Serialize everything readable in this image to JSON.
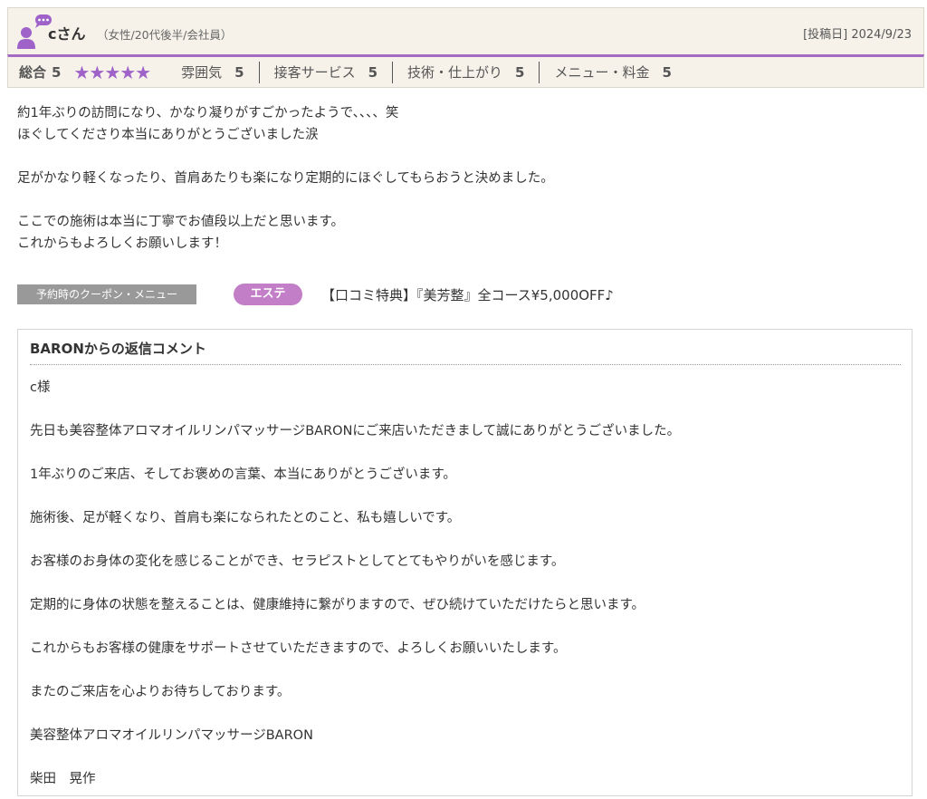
{
  "reviewer": {
    "name": "cさん",
    "attributes": "（女性/20代後半/会社員）",
    "post_date": "[投稿日] 2024/9/23",
    "avatar_icon": "user-comment-icon"
  },
  "ratings": {
    "overall_label": "総合",
    "overall_score": "5",
    "stars_text": "★★★★★",
    "star_count": 5,
    "star_color": "#9e62c9",
    "categories": [
      {
        "label": "雰囲気",
        "score": "5"
      },
      {
        "label": "接客サービス",
        "score": "5"
      },
      {
        "label": "技術・仕上がり",
        "score": "5"
      },
      {
        "label": "メニュー・料金",
        "score": "5"
      }
    ]
  },
  "review_body": "約1年ぶりの訪問になり、かなり凝りがすごかったようで、、、、笑\nほぐしてくださり本当にありがとうございました涙\n\n足がかなり軽くなったり、首肩あたりも楽になり定期的にほぐしてもらおうと決めました。\n\nここでの施術は本当に丁寧でお値段以上だと思います。\nこれからもよろしくお願いします！",
  "coupon": {
    "tag_label": "予約時のクーポン・メニュー",
    "genre": "エステ",
    "genre_color": "#c27ec7",
    "name": "【口コミ特典】『美芳整』全コース¥5,000OFF♪"
  },
  "reply": {
    "title": "BARONからの返信コメント",
    "text": "c様\n\n先日も美容整体アロマオイルリンパマッサージBARONにご来店いただきまして誠にありがとうございました。\n\n1年ぶりのご来店、そしてお褒めの言葉、本当にありがとうございます。\n\n施術後、足が軽くなり、首肩も楽になられたとのこと、私も嬉しいです。\n\nお客様のお身体の変化を感じることができ、セラピストとしてとてもやりがいを感じます。\n\n定期的に身体の状態を整えることは、健康維持に繋がりますので、ぜひ続けていただけたらと思います。\n\nこれからもお客様の健康をサポートさせていただきますので、よろしくお願いいたします。\n\nまたのご来店を心よりお待ちしております。\n\n美容整体アロマオイルリンパマッサージBARON\n\n柴田　晃作"
  },
  "colors": {
    "accent": "#a56bc4",
    "header_bg": "#f6f2ea"
  }
}
